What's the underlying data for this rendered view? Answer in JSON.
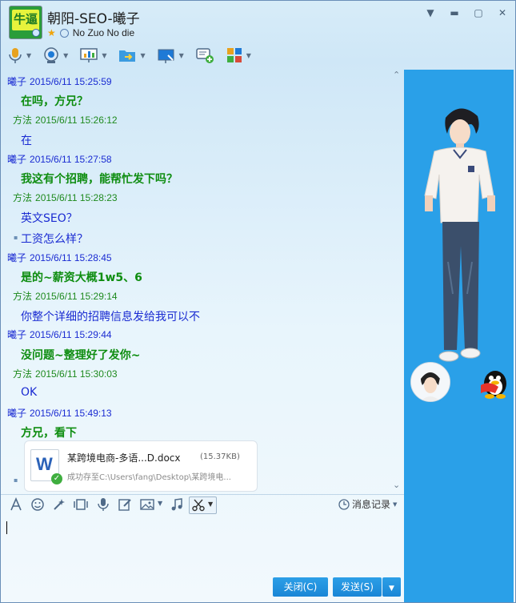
{
  "window": {
    "title": "朝阳-SEO-曦子",
    "signature": "No Zuo No die",
    "avatar_text": "牛逼"
  },
  "toolbar": {
    "items": [
      "mic-icon",
      "camera-icon",
      "screen-share-icon",
      "file-transfer-icon",
      "remote-assist-icon",
      "new-group-chat-icon",
      "apps-icon"
    ]
  },
  "messages": [
    {
      "sender": "曦子",
      "time": "2015/6/11 15:25:59",
      "lines": [
        "在吗，方兄？"
      ],
      "style": "bold"
    },
    {
      "sender": "方法",
      "time": "2015/6/11 15:26:12",
      "lines": [
        "在"
      ],
      "style": "blue"
    },
    {
      "sender": "曦子",
      "time": "2015/6/11 15:27:58",
      "lines": [
        "我这有个招聘，能帮忙发下吗？"
      ],
      "style": "bold"
    },
    {
      "sender": "方法",
      "time": "2015/6/11 15:28:23",
      "lines": [
        "英文SEO？",
        "工资怎么样？"
      ],
      "style": "blue"
    },
    {
      "sender": "曦子",
      "time": "2015/6/11 15:28:45",
      "lines": [
        "是的~薪资大概1w5、6"
      ],
      "style": "bold"
    },
    {
      "sender": "方法",
      "time": "2015/6/11 15:29:14",
      "lines": [
        "你整个详细的招聘信息发给我可以不"
      ],
      "style": "blue"
    },
    {
      "sender": "曦子",
      "time": "2015/6/11 15:29:44",
      "lines": [
        "没问题~整理好了发你~"
      ],
      "style": "bold"
    },
    {
      "sender": "方法",
      "time": "2015/6/11 15:30:03",
      "lines": [
        "OK"
      ],
      "style": "blue"
    },
    {
      "sender": "曦子",
      "time": "2015/6/11 15:49:13",
      "lines": [
        "方兄，看下"
      ],
      "style": "bold"
    }
  ],
  "file": {
    "name": "某跨境电商-多语...D.docx",
    "size": "(15.37KB)",
    "status": "成功存至C:\\Users\\fang\\Desktop\\某跨境电..."
  },
  "input_toolbar": {
    "history_label": "消息记录"
  },
  "buttons": {
    "close_label": "关闭(C)",
    "send_label": "发送(S)"
  },
  "colors": {
    "own_name": "#1a2bd2",
    "other_name": "#1e8a1e",
    "bold_msg": "#0e8d10",
    "blue_msg": "#1a2bd2",
    "side_panel": "#2aa0e8",
    "button": "#1a86d6"
  }
}
